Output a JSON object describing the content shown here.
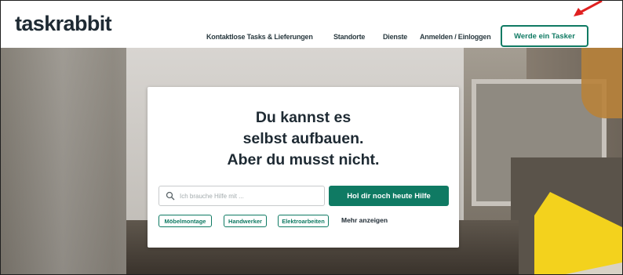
{
  "header": {
    "logo": "taskrabbit",
    "nav": [
      "Kontaktlose Tasks & Lieferungen",
      "Standorte",
      "Dienste",
      "Anmelden / Einloggen"
    ],
    "cta": "Werde ein Tasker"
  },
  "hero": {
    "headline_lines": [
      "Du kannst es",
      "selbst aufbauen.",
      "Aber du musst nicht."
    ],
    "search": {
      "placeholder": "Ich brauche Hilfe mit ...",
      "value": ""
    },
    "search_button": "Hol dir noch heute Hilfe",
    "chips": [
      "Möbelmontage",
      "Handwerker",
      "Elektroarbeiten"
    ],
    "more_link": "Mehr anzeigen"
  },
  "colors": {
    "brand_green": "#0f7a63",
    "text_dark": "#1e2a33",
    "annotation_red": "#e02020",
    "accent_yellow": "#f3d21d"
  },
  "icons": {
    "search": "search-icon",
    "annotation": "arrow-icon"
  }
}
